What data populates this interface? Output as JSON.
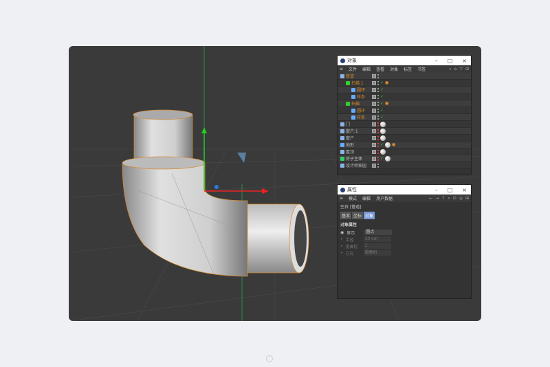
{
  "objects_panel": {
    "title": "对象",
    "menu": [
      "文件",
      "编辑",
      "查看",
      "对象",
      "标签",
      "书签"
    ],
    "items": [
      {
        "name": "管道",
        "level": 0,
        "color": "orange",
        "icon": "null-icon"
      },
      {
        "name": "扫描.1",
        "level": 1,
        "color": "orange",
        "icon": "sweep-icon"
      },
      {
        "name": "圆环",
        "level": 2,
        "color": "orange",
        "icon": "circle-icon"
      },
      {
        "name": "样条",
        "level": 2,
        "color": "orange",
        "icon": "spline-icon"
      },
      {
        "name": "扫描",
        "level": 1,
        "color": "orange",
        "icon": "sweep-icon"
      },
      {
        "name": "圆环",
        "level": 2,
        "color": "orange",
        "icon": "circle-icon"
      },
      {
        "name": "样条",
        "level": 2,
        "color": "orange",
        "icon": "spline-icon"
      },
      {
        "name": "门",
        "level": 0,
        "color": "grey",
        "icon": "null-icon"
      },
      {
        "name": "窗户.1",
        "level": 0,
        "color": "grey",
        "icon": "null-icon"
      },
      {
        "name": "窗户",
        "level": 0,
        "color": "grey",
        "icon": "null-icon"
      },
      {
        "name": "地形",
        "level": 0,
        "color": "grey",
        "icon": "landscape-icon"
      },
      {
        "name": "屋顶",
        "level": 0,
        "color": "grey",
        "icon": "null-icon"
      },
      {
        "name": "房子主体",
        "level": 0,
        "color": "grey",
        "icon": "object-icon"
      },
      {
        "name": "设计师家园",
        "level": 0,
        "color": "grey",
        "icon": "null-icon"
      }
    ]
  },
  "attributes_panel": {
    "title": "属性",
    "menu": [
      "模式",
      "编辑",
      "用户数据"
    ],
    "object_label": "空白 [管道]",
    "tabs": [
      "基本",
      "坐标",
      "对象"
    ],
    "active_tab": "对象",
    "section": "对象属性",
    "fields": [
      {
        "label": "显示",
        "value": "圆点"
      },
      {
        "label": "半径",
        "value": "10 cm"
      },
      {
        "label": "宽高比",
        "value": "1"
      },
      {
        "label": "方向",
        "value": "摄像机"
      }
    ]
  },
  "colors": {
    "accent": "#7a9ad6",
    "selected_name": "#d98a2a"
  }
}
